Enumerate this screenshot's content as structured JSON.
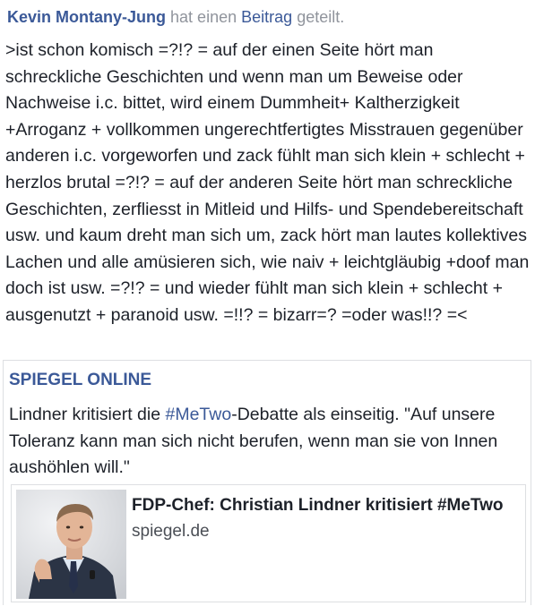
{
  "post": {
    "author": "Kevin Montany-Jung",
    "action_prefix": "hat einen",
    "action_link": "Beitrag",
    "action_suffix": "geteilt.",
    "text": ">ist schon komisch =?!? = auf der einen Seite hört man schreckliche Geschichten und wenn man um Beweise oder Nachweise i.c. bittet, wird einem Dummheit+ Kaltherzigkeit +Arroganz + vollkommen ungerechtfertigtes Misstrauen gegenüber anderen i.c. vorgeworfen und zack fühlt man sich klein + schlecht + herzlos brutal =?!? = auf der anderen Seite hört man schreckliche Geschichten, zerfliesst in Mitleid und Hilfs- und Spendebereitschaft usw. und kaum dreht man sich um, zack hört man lautes kollektives Lachen und alle amüsieren sich, wie naiv + leichtgläubig +doof man doch ist usw. =?!? = und wieder fühlt man sich klein + schlecht + ausgenutzt + paranoid usw. =!!? = bizarr=? =oder was!!? =<"
  },
  "shared_post": {
    "page_name": "SPIEGEL ONLINE",
    "text_before": "Lindner kritisiert die ",
    "hashtag": "#MeTwo",
    "text_after": "-Debatte als einseitig. \"Auf unsere Toleranz kann man sich nicht berufen, wenn man sie von Innen aushöhlen will.\"",
    "link_card": {
      "title": "FDP-Chef: Christian Lindner kritisiert #MeTwo",
      "domain": "spiegel.de",
      "thumbnail_icon": "politician-photo"
    }
  },
  "colors": {
    "link": "#3b5998",
    "text": "#1d2129",
    "meta": "#90949c",
    "border": "#dddfe2"
  }
}
